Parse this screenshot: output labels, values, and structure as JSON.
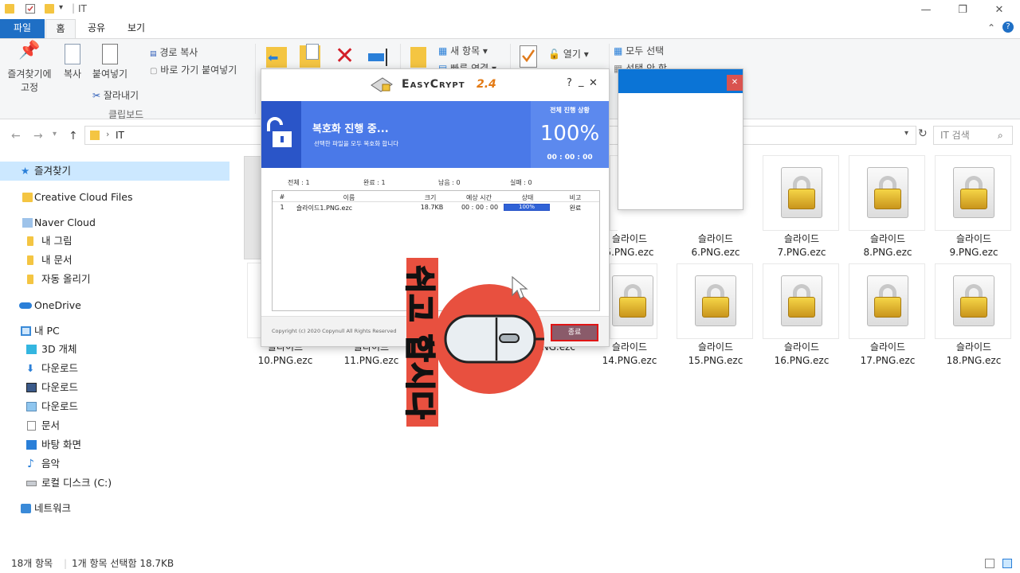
{
  "window": {
    "title": "IT",
    "quick_access_sep": "|"
  },
  "ribbon": {
    "tabs": [
      "파일",
      "홈",
      "공유",
      "보기"
    ],
    "clipboard": {
      "pin_label_1": "즐겨찾기에",
      "pin_label_2": "고정",
      "copy": "복사",
      "paste": "붙여넣기",
      "copy_path": "경로 복사",
      "paste_shortcut": "바로 가기 붙여넣기",
      "cut": "잘라내기",
      "group": "클립보드"
    },
    "new": {
      "new_item": "새 항목",
      "easy_access": "빠른 연결"
    },
    "open": {
      "open": "열기"
    },
    "select": {
      "select_all": "모두 선택",
      "select_none": "선택 안 함"
    }
  },
  "address": {
    "path": "IT",
    "search_placeholder": "IT 검색"
  },
  "sidebar": {
    "items": [
      {
        "label": "즐겨찾기"
      },
      {
        "label": "Creative Cloud Files"
      },
      {
        "label": "Naver Cloud"
      },
      {
        "label": "내 그림"
      },
      {
        "label": "내 문서"
      },
      {
        "label": "자동 올리기"
      },
      {
        "label": "OneDrive"
      },
      {
        "label": "내 PC"
      },
      {
        "label": "3D 개체"
      },
      {
        "label": "다운로드"
      },
      {
        "label": "다운로드"
      },
      {
        "label": "다운로드"
      },
      {
        "label": "문서"
      },
      {
        "label": "바탕 화면"
      },
      {
        "label": "음악"
      },
      {
        "label": "로컬 디스크 (C:)"
      },
      {
        "label": "네트워크"
      }
    ]
  },
  "files": {
    "row1": [
      {
        "l1": "슬라이드",
        "l2": "5.PNG.ezc"
      },
      {
        "l1": "슬라이드",
        "l2": "6.PNG.ezc"
      },
      {
        "l1": "슬라이드",
        "l2": "7.PNG.ezc"
      },
      {
        "l1": "슬라이드",
        "l2": "8.PNG.ezc"
      },
      {
        "l1": "슬라이드",
        "l2": "9.PNG.ezc"
      }
    ],
    "row2": [
      {
        "l1": "슬라이드",
        "l2": "10.PNG.ezc"
      },
      {
        "l1": "슬라이드",
        "l2": "11.PNG.ezc"
      },
      {
        "l1": "",
        "l2": "PNG.ezc"
      },
      {
        "l1": "슬라이드",
        "l2": "14.PNG.ezc"
      },
      {
        "l1": "슬라이드",
        "l2": "15.PNG.ezc"
      },
      {
        "l1": "슬라이드",
        "l2": "16.PNG.ezc"
      },
      {
        "l1": "슬라이드",
        "l2": "17.PNG.ezc"
      },
      {
        "l1": "슬라이드",
        "l2": "18.PNG.ezc"
      }
    ]
  },
  "status": {
    "count": "18개 항목",
    "selected": "1개 항목 선택함 18.7KB"
  },
  "easycrypt": {
    "brand": "EasyCrypt",
    "version": "2.4",
    "help": "?",
    "min": "_",
    "close": "✕",
    "banner_title": "복호화 진행 중...",
    "banner_sub": "선택한 파일을 모두 복호화 합니다",
    "progress_label": "전체 진행 상황",
    "progress_pct": "100%",
    "progress_time": "00 : 00 : 00",
    "progress_fraction": 1.0,
    "stats": {
      "total": "전체 : 1",
      "done": "완료 : 1",
      "remain": "남음 : 0",
      "fail": "실패 : 0"
    },
    "columns": [
      "#",
      "이름",
      "크기",
      "예상 시간",
      "상태",
      "비고"
    ],
    "rows": [
      {
        "n": "1",
        "name": "슬라이드1.PNG.ezc",
        "size": "18.7KB",
        "eta": "00 : 00 : 00",
        "state": "100%",
        "state_fraction": 1.0,
        "note": "완료"
      }
    ],
    "copyright": "Copyright (c) 2020 Copynull All Rights Reserved",
    "finish_button": "종료"
  },
  "blank_dialog": {
    "close": "✕"
  },
  "overlay": {
    "text": "쉬고 합시다"
  },
  "colors": {
    "accent": "#1f6fc5",
    "banner": "#4a79e8",
    "overlay": "#e8503f",
    "finish_border": "#e01515"
  }
}
